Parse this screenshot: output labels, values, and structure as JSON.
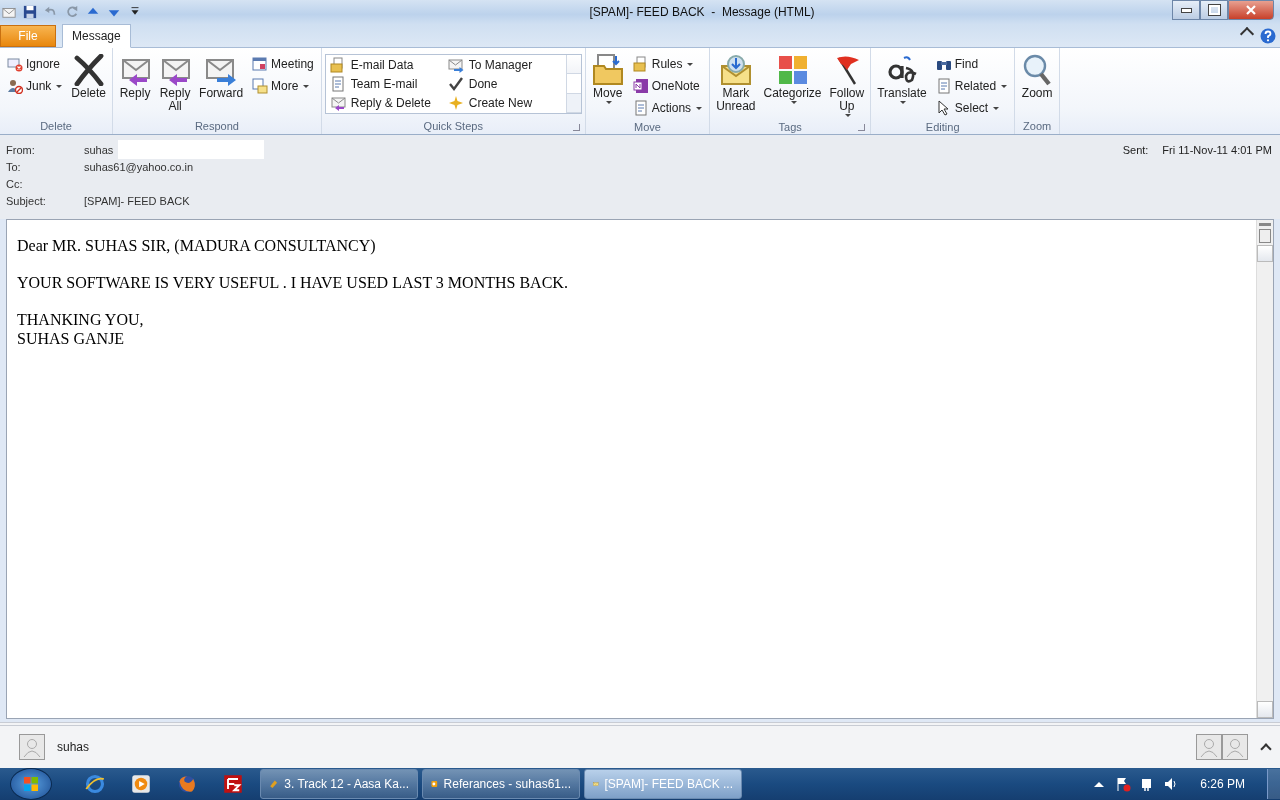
{
  "window": {
    "title": "[SPAM]- FEED BACK  -  Message (HTML)"
  },
  "tabs": [
    {
      "label": "File",
      "kind": "file",
      "selected": false
    },
    {
      "label": "Message",
      "kind": "tab",
      "selected": true
    }
  ],
  "ribbon": [
    {
      "label": "Delete",
      "launcher": false,
      "items": [
        {
          "kind": "stack",
          "items": [
            {
              "label": "Ignore",
              "dropdown": false
            },
            {
              "label": "Junk",
              "dropdown": true
            }
          ]
        },
        {
          "kind": "large",
          "label": "Delete",
          "dropdown": false
        }
      ]
    },
    {
      "label": "Respond",
      "launcher": false,
      "items": [
        {
          "kind": "large",
          "label": "Reply",
          "dropdown": false
        },
        {
          "kind": "large",
          "label": "Reply All",
          "dropdown": false
        },
        {
          "kind": "large",
          "label": "Forward",
          "dropdown": false
        },
        {
          "kind": "stack",
          "items": [
            {
              "label": "Meeting",
              "dropdown": false
            },
            {
              "label": "More",
              "dropdown": true
            }
          ]
        }
      ]
    },
    {
      "label": "Quick Steps",
      "launcher": true,
      "items": [
        {
          "kind": "gallery",
          "items": [
            {
              "label": "E-mail Data"
            },
            {
              "label": "Team E-mail"
            },
            {
              "label": "Reply & Delete"
            },
            {
              "label": "To Manager"
            },
            {
              "label": "Done"
            },
            {
              "label": "Create New"
            }
          ]
        }
      ]
    },
    {
      "label": "Move",
      "launcher": false,
      "items": [
        {
          "kind": "large",
          "label": "Move",
          "dropdown": true
        },
        {
          "kind": "stack",
          "items": [
            {
              "label": "Rules",
              "dropdown": true
            },
            {
              "label": "OneNote",
              "dropdown": false
            },
            {
              "label": "Actions",
              "dropdown": true
            }
          ]
        }
      ]
    },
    {
      "label": "Tags",
      "launcher": true,
      "items": [
        {
          "kind": "large",
          "label": "Mark Unread",
          "dropdown": false
        },
        {
          "kind": "large",
          "label": "Categorize",
          "dropdown": true
        },
        {
          "kind": "large",
          "label": "Follow Up",
          "dropdown": true
        }
      ]
    },
    {
      "label": "Editing",
      "launcher": false,
      "items": [
        {
          "kind": "large",
          "label": "Translate",
          "dropdown": true
        },
        {
          "kind": "stack",
          "items": [
            {
              "label": "Find",
              "dropdown": false
            },
            {
              "label": "Related",
              "dropdown": true
            },
            {
              "label": "Select",
              "dropdown": true
            }
          ]
        }
      ]
    },
    {
      "label": "Zoom",
      "launcher": false,
      "items": [
        {
          "kind": "large",
          "label": "Zoom",
          "dropdown": false
        }
      ]
    }
  ],
  "header": {
    "fields": [
      {
        "label": "From:",
        "value": "suhas",
        "redacted": true
      },
      {
        "label": "To:",
        "value": "suhas61@yahoo.co.in",
        "redacted": false
      },
      {
        "label": "Cc:",
        "redacted": false
      },
      {
        "label": "Subject:",
        "value": "[SPAM]- FEED BACK",
        "redacted": false
      }
    ],
    "sent": {
      "label": "Sent:",
      "value": "Fri 11-Nov-11 4:01 PM"
    }
  },
  "body": {
    "paragraphs": [
      [
        "Dear MR. SUHAS SIR, (MADURA CONSULTANCY)"
      ],
      [
        "YOUR SOFTWARE IS VERY USEFUL . I HAVE USED LAST 3 MONTHS BACK."
      ],
      [
        "THANKING YOU,",
        "SUHAS GANJE"
      ]
    ]
  },
  "people_pane": {
    "name": "suhas"
  },
  "taskbar": {
    "buttons": [
      {
        "label": "3. Track 12 - Aasa Ka...",
        "selected": false
      },
      {
        "label": "Referances - suhas61...",
        "selected": false
      },
      {
        "label": "[SPAM]- FEED BACK ...",
        "selected": true
      }
    ],
    "clock": "6:26 PM"
  }
}
